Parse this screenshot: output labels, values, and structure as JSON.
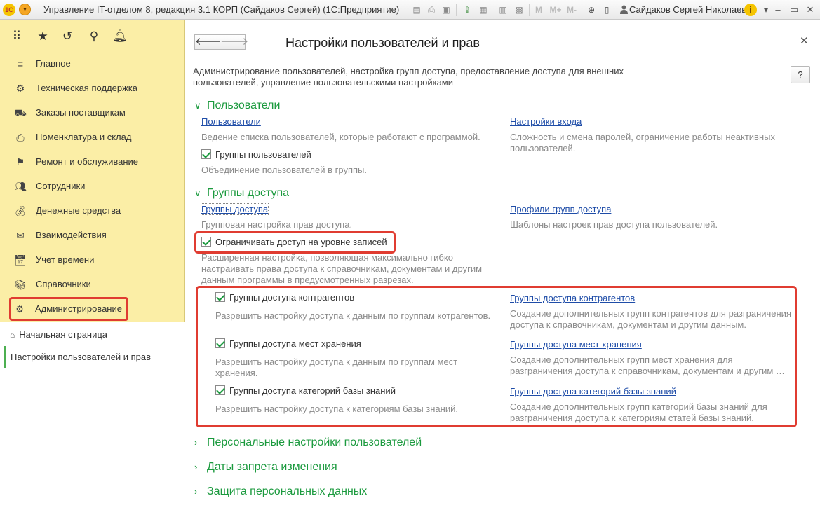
{
  "titlebar": {
    "logo": "1С",
    "title": "Управление IT-отделом 8, редакция 3.1 КОРП (Сайдаков Сергей)  (1С:Предприятие)",
    "user": "Сайдаков Сергей Николаевич",
    "icons": [
      "save-icon",
      "print-icon",
      "preview-icon",
      "upload-icon",
      "docs-icon",
      "calendar-icon",
      "m-icon",
      "m-plus-icon",
      "m-minus-icon",
      "zoom-icon",
      "panel-icon"
    ],
    "m": "M",
    "m_plus": "M+",
    "m_minus": "M-"
  },
  "sidebar": {
    "top_icons": [
      "apps-icon",
      "star-icon",
      "history-icon",
      "search-icon",
      "bell-icon"
    ],
    "items": [
      {
        "label": "Главное",
        "icon": "menu-icon"
      },
      {
        "label": "Техническая поддержка",
        "icon": "support-icon"
      },
      {
        "label": "Заказы поставщикам",
        "icon": "truck-icon"
      },
      {
        "label": "Номенклатура и склад",
        "icon": "printer-icon"
      },
      {
        "label": "Ремонт и обслуживание",
        "icon": "flag-icon"
      },
      {
        "label": "Сотрудники",
        "icon": "people-icon"
      },
      {
        "label": "Денежные средства",
        "icon": "money-icon"
      },
      {
        "label": "Взаимодействия",
        "icon": "mail-icon"
      },
      {
        "label": "Учет времени",
        "icon": "calendar-icon"
      },
      {
        "label": "Справочники",
        "icon": "books-icon"
      },
      {
        "label": "Администрирование",
        "icon": "gear-icon"
      }
    ],
    "home": "Начальная страница",
    "open_tab": "Настройки пользователей и прав"
  },
  "main": {
    "title": "Настройки пользователей и прав",
    "help": "?",
    "description": "Администрирование пользователей, настройка групп доступа, предоставление доступа для внешних пользователей, управление пользовательскими настройками",
    "users_section": {
      "title": "Пользователи",
      "users_link": "Пользователи",
      "users_note": "Ведение списка пользователей, которые работают с программой.",
      "login_link": "Настройки входа",
      "login_note": "Сложность и смена паролей, ограничение работы неактивных пользователей.",
      "groups_check": "Группы пользователей",
      "groups_note": "Объединение пользователей в группы."
    },
    "access_section": {
      "title": "Группы доступа",
      "groups_link": "Группы доступа",
      "groups_note": "Групповая настройка прав доступа.",
      "profiles_link": "Профили групп доступа",
      "profiles_note": "Шаблоны настроек прав доступа пользователей.",
      "record_check": "Ограничивать доступ на уровне записей",
      "record_note": "Расширенная настройка, позволяющая максимально гибко настраивать права доступа к справочникам, документам и другим данным программы в предусмотренных разрезах.",
      "rows": [
        {
          "check": "Группы доступа контрагентов",
          "check_note": "Разрешить настройку доступа к данным по группам котрагентов.",
          "link": "Группы доступа контрагентов",
          "link_note": "Создание дополнительных групп контрагентов для разграничения доступа к справочникам, документам и другим данным."
        },
        {
          "check": "Группы доступа мест хранения",
          "check_note": "Разрешить настройку доступа к данным по группам мест хранения.",
          "link": "Группы доступа мест хранения",
          "link_note": "Создание дополнительных групп мест хранения для разграничения доступа к справочникам, документам и другим …"
        },
        {
          "check": "Группы доступа категорий базы знаний",
          "check_note": "Разрешить настройку доступа к категориям базы знаний.",
          "link": "Группы доступа категорий базы знаний",
          "link_note": "Создание дополнительных групп категорий базы знаний для разграничения доступа к категориям статей базы знаний."
        }
      ]
    },
    "collapsed_sections": [
      "Персональные настройки пользователей",
      "Даты запрета изменения",
      "Защита персональных данных"
    ]
  }
}
